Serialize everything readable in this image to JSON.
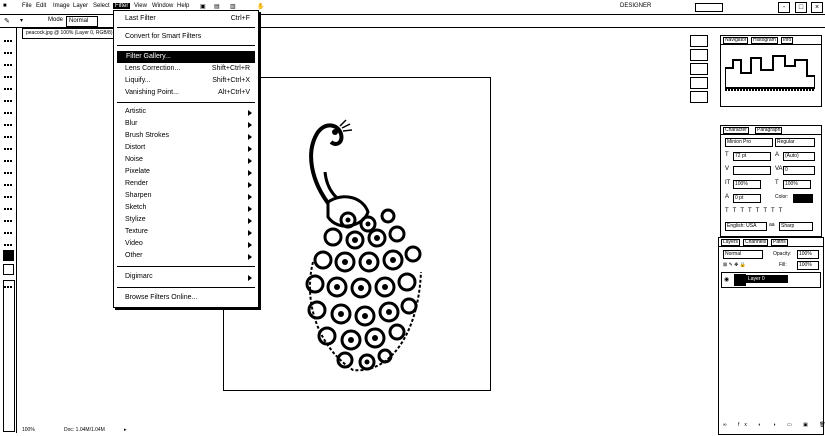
{
  "menubar": {
    "app_icon": "app-logo-icon",
    "items": [
      "File",
      "Edit",
      "Image",
      "Layer",
      "Select",
      "Filter",
      "View",
      "Window",
      "Help"
    ],
    "right_label": "DESIGNER",
    "window_controls": [
      "-",
      "□",
      "×"
    ]
  },
  "options": {
    "mode_label": "Mode",
    "mode_value": "Normal"
  },
  "document": {
    "tab_title": "peacock.jpg @ 100% (Layer 0, RGB/8)"
  },
  "filter_menu": {
    "items": [
      {
        "label": "Last Filter",
        "shortcut": "Ctrl+F"
      },
      {
        "label": "Convert for Smart Filters",
        "shortcut": ""
      },
      {
        "label": "Filter Gallery...",
        "shortcut": "",
        "highlighted": true
      },
      {
        "label": "Lens Correction...",
        "shortcut": "Shift+Ctrl+R"
      },
      {
        "label": "Liquify...",
        "shortcut": "Shift+Ctrl+X"
      },
      {
        "label": "Vanishing Point...",
        "shortcut": "Alt+Ctrl+V"
      },
      {
        "label": "Artistic",
        "submenu": true
      },
      {
        "label": "Blur",
        "submenu": true
      },
      {
        "label": "Brush Strokes",
        "submenu": true
      },
      {
        "label": "Distort",
        "submenu": true
      },
      {
        "label": "Noise",
        "submenu": true
      },
      {
        "label": "Pixelate",
        "submenu": true
      },
      {
        "label": "Render",
        "submenu": true
      },
      {
        "label": "Sharpen",
        "submenu": true
      },
      {
        "label": "Sketch",
        "submenu": true
      },
      {
        "label": "Stylize",
        "submenu": true
      },
      {
        "label": "Texture",
        "submenu": true
      },
      {
        "label": "Video",
        "submenu": true
      },
      {
        "label": "Other",
        "submenu": true
      },
      {
        "label": "Digimarc",
        "submenu": true
      },
      {
        "label": "Browse Filters Online...",
        "shortcut": ""
      }
    ]
  },
  "panels": {
    "navigator_tabs": [
      "Navigator",
      "Histogram",
      "Info"
    ],
    "character_tabs": [
      "Character",
      "Paragraph"
    ],
    "character": {
      "font": "Minion Pro",
      "style": "Regular",
      "size": "72 pt",
      "leading": "(Auto)",
      "tracking": "0",
      "scale_v": "100%",
      "scale_h": "100%",
      "baseline": "0 pt",
      "color_label": "Color:",
      "aa": "Sharp",
      "lang": "English: USA"
    },
    "layers_tabs": [
      "Layers",
      "Channels",
      "Paths"
    ],
    "layers": {
      "blend": "Normal",
      "opacity_label": "Opacity:",
      "opacity": "100%",
      "fill_label": "Fill:",
      "fill": "100%",
      "layer_name": "Layer 0"
    }
  },
  "status": {
    "zoom": "100%",
    "doc_info": "Doc: 1.04M/1.04M"
  }
}
